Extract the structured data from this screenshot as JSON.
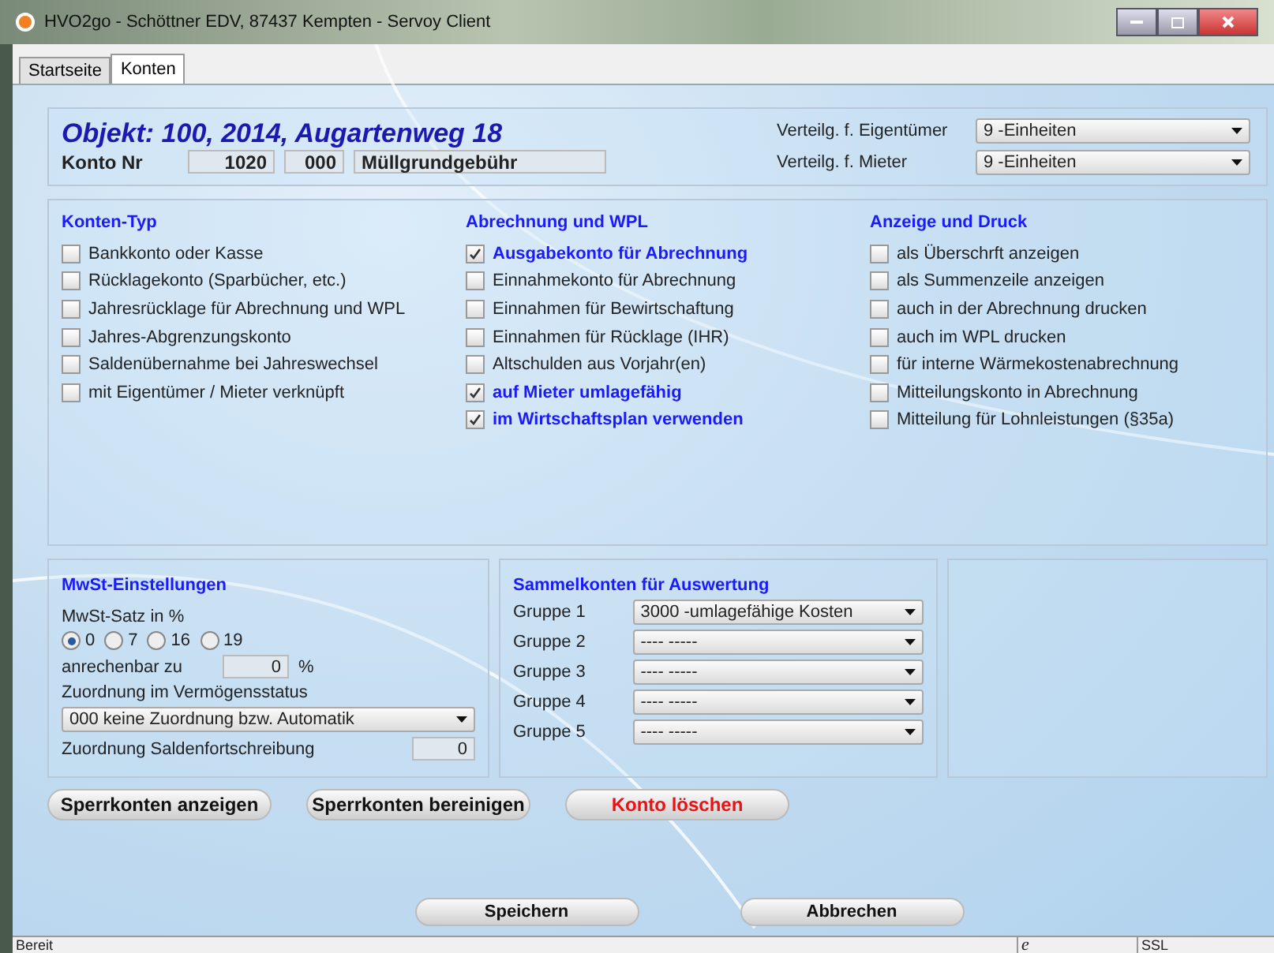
{
  "window": {
    "title": "HVO2go - Schöttner EDV, 87437 Kempten  - Servoy Client"
  },
  "tabs": [
    {
      "label": "Startseite",
      "selected": false
    },
    {
      "label": "Konten",
      "selected": true
    }
  ],
  "header": {
    "object_title": "Objekt: 100, 2014, Augartenweg 18",
    "konto_label": "Konto Nr",
    "konto_nr": "1020",
    "sub_nr": "000",
    "konto_name": "Müllgrundgebühr",
    "distributions": [
      {
        "label": "Verteilg. f. Eigentümer",
        "value": "9 -Einheiten"
      },
      {
        "label": "Verteilg. f. Mieter",
        "value": "9 -Einheiten"
      }
    ]
  },
  "check_groups": [
    {
      "title": "Konten-Typ",
      "items": [
        {
          "label": "Bankkonto oder Kasse",
          "checked": false
        },
        {
          "label": "Rücklagekonto (Sparbücher, etc.)",
          "checked": false
        },
        {
          "label": "Jahresrücklage für Abrechnung und WPL",
          "checked": false
        },
        {
          "label": "Jahres-Abgrenzungskonto",
          "checked": false
        },
        {
          "label": "Saldenübernahme bei Jahreswechsel",
          "checked": false
        },
        {
          "label": "mit Eigentümer / Mieter verknüpft",
          "checked": false
        }
      ]
    },
    {
      "title": "Abrechnung und WPL",
      "items": [
        {
          "label": "Ausgabekonto für Abrechnung",
          "checked": true
        },
        {
          "label": "Einnahmekonto für Abrechnung",
          "checked": false
        },
        {
          "label": "Einnahmen für Bewirtschaftung",
          "checked": false
        },
        {
          "label": "Einnahmen für Rücklage (IHR)",
          "checked": false
        },
        {
          "label": "Altschulden aus Vorjahr(en)",
          "checked": false
        },
        {
          "label": "auf Mieter umlagefähig",
          "checked": true
        },
        {
          "label": "im Wirtschaftsplan verwenden",
          "checked": true
        }
      ]
    },
    {
      "title": "Anzeige und Druck",
      "items": [
        {
          "label": "als Überschrft anzeigen",
          "checked": false
        },
        {
          "label": "als Summenzeile anzeigen",
          "checked": false
        },
        {
          "label": "auch in der Abrechnung drucken",
          "checked": false
        },
        {
          "label": "auch im WPL drucken",
          "checked": false
        },
        {
          "label": "für interne Wärmekostenabrechnung",
          "checked": false
        },
        {
          "label": "Mitteilungskonto in Abrechnung",
          "checked": false
        },
        {
          "label": "Mitteilung für Lohnleistungen (§35a)",
          "checked": false
        }
      ]
    }
  ],
  "mwst": {
    "title": "MwSt-Einstellungen",
    "rate_label": "MwSt-Satz in %",
    "rates": [
      {
        "label": "0",
        "selected": true
      },
      {
        "label": "7",
        "selected": false
      },
      {
        "label": "16",
        "selected": false
      },
      {
        "label": "19",
        "selected": false
      }
    ],
    "creditable_label": "anrechenbar zu",
    "creditable_value": "0",
    "percent": "%",
    "assignment_label": "Zuordnung im Vermögensstatus",
    "assignment_value": "000 keine Zuordnung bzw. Automatik",
    "balance_label": "Zuordnung Saldenfortschreibung",
    "balance_value": "0"
  },
  "sammelkonten": {
    "title": "Sammelkonten für Auswertung",
    "groups": [
      {
        "label": "Gruppe 1",
        "value": "3000 -umlagefähige Kosten"
      },
      {
        "label": "Gruppe 2",
        "value": "---- -----"
      },
      {
        "label": "Gruppe 3",
        "value": "---- -----"
      },
      {
        "label": "Gruppe 4",
        "value": "---- -----"
      },
      {
        "label": "Gruppe 5",
        "value": "---- -----"
      }
    ]
  },
  "actions": [
    {
      "label": "Sperrkonten anzeigen",
      "kind": "normal"
    },
    {
      "label": "Sperrkonten bereinigen",
      "kind": "normal"
    },
    {
      "label": "Konto löschen",
      "kind": "danger"
    }
  ],
  "footer_buttons": [
    "Speichern",
    "Abbrechen"
  ],
  "status_bar": {
    "text": "Bereit",
    "browser_glyph": "e",
    "ssl": "SSL"
  }
}
